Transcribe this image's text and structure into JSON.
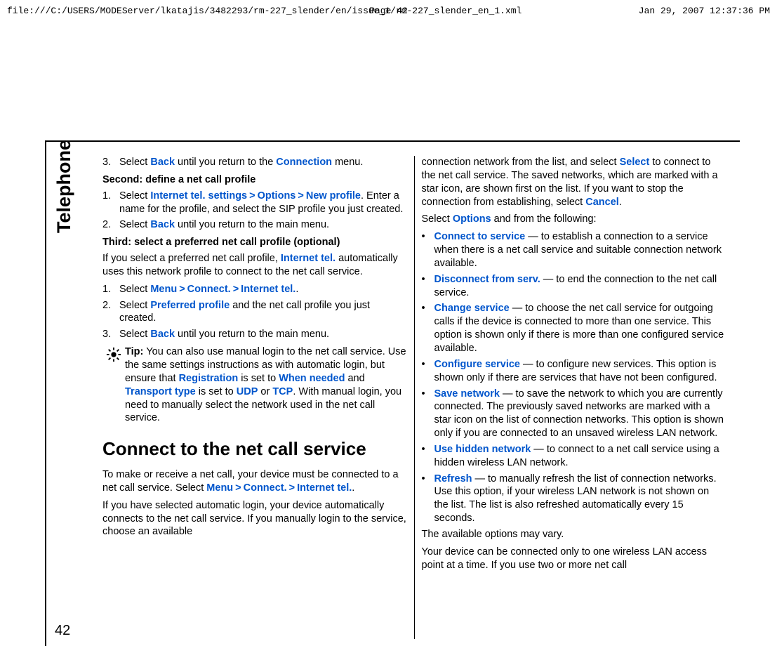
{
  "header": {
    "file_path": "file:///C:/USERS/MODEServer/lkatajis/3482293/rm-227_slender/en/issue_1/rm-227_slender_en_1.xml",
    "page_label": "Page 42",
    "timestamp": "Jan 29, 2007 12:37:36 PM"
  },
  "sidebar": {
    "section_title": "Telephone",
    "page_number": "42"
  },
  "col1": {
    "step3_a": "3.",
    "step3_text1": "Select ",
    "step3_link1": "Back",
    "step3_text2": " until you return to the ",
    "step3_link2": "Connection",
    "step3_text3": " menu.",
    "second_heading": "Second: define a net call profile",
    "second_step1_num": "1.",
    "second_step1_t1": "Select ",
    "second_step1_l1": "Internet tel. settings",
    "second_step1_l2": "Options",
    "second_step1_l3": "New profile",
    "second_step1_t2": ". Enter a name for the profile, and select the SIP profile you just created.",
    "second_step2_num": "2.",
    "second_step2_t1": "Select ",
    "second_step2_l1": "Back",
    "second_step2_t2": " until you return to the main menu.",
    "third_heading": "Third: select a preferred net call profile (optional)",
    "third_para_t1": "If you select a preferred net call profile, ",
    "third_para_l1": "Internet tel.",
    "third_para_t2": " automatically uses this network profile to connect to the net call service.",
    "third_step1_num": "1.",
    "third_step1_t1": "Select ",
    "third_step1_l1": "Menu",
    "third_step1_l2": "Connect.",
    "third_step1_l3": "Internet tel.",
    "third_step1_t2": ".",
    "third_step2_num": "2.",
    "third_step2_t1": "Select ",
    "third_step2_l1": "Preferred profile",
    "third_step2_t2": " and the net call profile you just created.",
    "third_step3_num": "3.",
    "third_step3_t1": "Select ",
    "third_step3_l1": "Back",
    "third_step3_t2": " until you return to the main menu.",
    "tip_label": "Tip: ",
    "tip_t1": "You can also use manual login to the net call service. Use the same settings instructions as with automatic login, but ensure that ",
    "tip_l1": "Registration",
    "tip_t2": " is set to ",
    "tip_l2": "When needed",
    "tip_t3": " and ",
    "tip_l3": "Transport type",
    "tip_t4": " is set to ",
    "tip_l4": "UDP",
    "tip_t5": " or ",
    "tip_l5": "TCP",
    "tip_t6": ". With manual login, you need to manually select the network used in the net call service.",
    "connect_heading": "Connect to the net call service",
    "connect_p1_t1": "To make or receive a net call, your device must be connected to a net call service. Select ",
    "connect_p1_l1": "Menu",
    "connect_p1_l2": "Connect.",
    "connect_p1_l3": "Internet tel.",
    "connect_p1_t2": ".",
    "connect_p2": "If you have selected automatic login, your device automatically connects to the net call service. If you manually login to the service, choose an available"
  },
  "col2": {
    "p1_t1": "connection network from the list, and select ",
    "p1_l1": "Select",
    "p1_t2": " to connect to the net call service. The saved networks, which are marked with a star icon, are shown first on the list. If you want to stop the connection from establishing, select ",
    "p1_l2": "Cancel",
    "p1_t3": ".",
    "p2_t1": "Select ",
    "p2_l1": "Options",
    "p2_t2": " and from the following:",
    "bullets": [
      {
        "link": "Connect to service",
        "text": "  — to establish a connection to a service when there is a net call service and suitable connection network available."
      },
      {
        "link": "Disconnect from serv.",
        "text": " — to end the connection to the net call service."
      },
      {
        "link": "Change service",
        "text": " — to choose the net call service for outgoing calls if the device is connected to more than one service. This option is shown only if there is more than one configured service available."
      },
      {
        "link": "Configure service",
        "text": " — to configure new services. This option is shown only if there are services that have not been configured."
      },
      {
        "link": "Save network",
        "text": " — to save the network to which you are currently connected. The previously saved networks are marked with a star icon on the list of connection networks. This option is shown only if you are connected to an unsaved wireless LAN network."
      },
      {
        "link": "Use hidden network",
        "text": " — to connect to a net call service using a hidden wireless LAN network."
      },
      {
        "link": "Refresh",
        "text": " — to manually refresh the list of connection networks. Use this option, if your wireless LAN network is not shown on the list. The list is also refreshed automatically every 15 seconds."
      }
    ],
    "p3": "The available options may vary.",
    "p4": "Your device can be connected only to one wireless LAN access point at a time. If you use two or more net call"
  },
  "separator": ">"
}
